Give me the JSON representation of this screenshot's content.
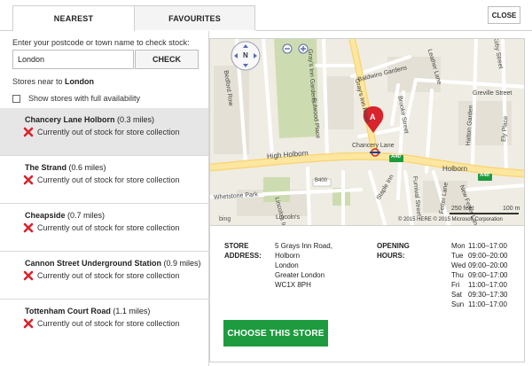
{
  "tabs": [
    {
      "label": "NEAREST",
      "active": true
    },
    {
      "label": "FAVOURITES",
      "active": false
    }
  ],
  "close_label": "CLOSE",
  "search": {
    "prompt": "Enter your postcode or town name to check stock:",
    "value": "London",
    "check_label": "CHECK"
  },
  "near": {
    "prefix": "Stores near to",
    "place": "London"
  },
  "availability_label": "Show stores with full availability",
  "stores": [
    {
      "name": "Chancery Lane Holborn",
      "distance": "(0.3 miles)",
      "stock": "Currently out of stock for store collection",
      "selected": true
    },
    {
      "name": "The Strand",
      "distance": "(0.6 miles)",
      "stock": "Currently out of stock for store collection",
      "selected": false
    },
    {
      "name": "Cheapside",
      "distance": "(0.7 miles)",
      "stock": "Currently out of stock for store collection",
      "selected": false
    },
    {
      "name": "Cannon Street Underground Station",
      "distance": "(0.9 miles)",
      "stock": "Currently out of stock for store collection",
      "selected": false
    },
    {
      "name": "Tottenham Court Road",
      "distance": "(1.1 miles)",
      "stock": "Currently out of stock for store collection",
      "selected": false
    }
  ],
  "map": {
    "compass": "N",
    "pin_letter": "A",
    "labels": {
      "high_holborn": "High Holborn",
      "holborn": "Holborn",
      "chancery_lane": "Chancery Lane",
      "a40_left": "A40",
      "a40_right": "A40",
      "b400": "B400",
      "baldwins": "Baldwins Gardens",
      "leather_lane": "Leather Lane",
      "greville": "Greville Street",
      "kirby": "Kirby Street",
      "ely": "Ely Place",
      "fulwood": "Fulwood Place",
      "brooke": "Brooke Street",
      "grays_inn": "Gray's Inn Road",
      "grays_inn_gardens": "Gray's Inn Gardens",
      "bedford_row": "Bedford Row",
      "whetstone": "Whetstone Park",
      "lincolns": "Lincoln's Inn",
      "lincoln_s": "Lincoln's",
      "staple": "Staple Inn",
      "furnival": "Furnival Street",
      "fetter": "Fetter Lane",
      "new_fetter": "New Fetter Lane",
      "hatton": "Hatton Garden",
      "scale_feet": "250 feet",
      "scale_m": "100 m",
      "bing": "bing",
      "copyright": "© 2015 HERE  © 2015 Microsoft Corporation"
    }
  },
  "details": {
    "address_label": "STORE ADDRESS:",
    "address_lines": [
      "5 Grays Inn Road,",
      "Holborn",
      "London",
      "Greater London",
      "WC1X 8PH"
    ],
    "hours_label": "OPENING HOURS:",
    "hours": [
      {
        "day": "Mon",
        "time": "11:00–17:00"
      },
      {
        "day": "Tue",
        "time": "09:00–20:00"
      },
      {
        "day": "Wed",
        "time": "09:00–20:00"
      },
      {
        "day": "Thu",
        "time": "09:00–17:00"
      },
      {
        "day": "Fri",
        "time": "11:00–17:00"
      },
      {
        "day": "Sat",
        "time": "09:30–17:30"
      },
      {
        "day": "Sun",
        "time": "11:00–17:00"
      }
    ],
    "choose_label": "CHOOSE THIS STORE"
  },
  "colors": {
    "accent_green": "#1e9b3f",
    "error_red": "#d9232d",
    "selected_bg": "#e6e6e6"
  }
}
